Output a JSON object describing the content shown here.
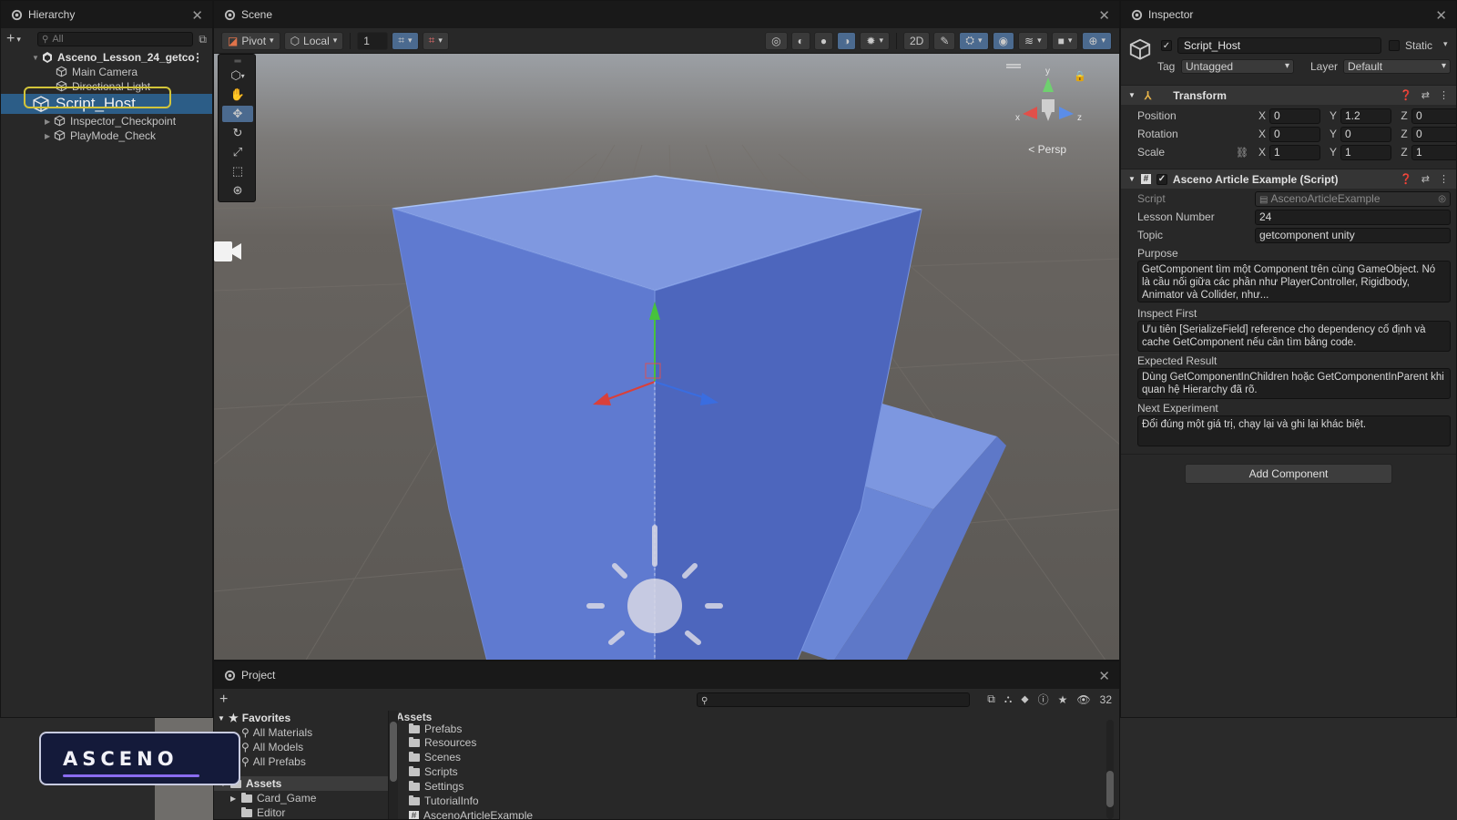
{
  "hierarchy": {
    "tab_title": "Hierarchy",
    "search_placeholder": "All",
    "items": [
      {
        "label": "Asceno_Lesson_24_getco",
        "type": "scene"
      },
      {
        "label": "Main Camera"
      },
      {
        "label": "Directional Light"
      },
      {
        "label": "Script_Host",
        "selected": true
      },
      {
        "label": "Inspector_Checkpoint"
      },
      {
        "label": "PlayMode_Check"
      }
    ]
  },
  "scene": {
    "tab_title": "Scene",
    "toolbar": {
      "pivot_label": "Pivot",
      "local_label": "Local",
      "grid_value": "1"
    },
    "persp_label": "< Persp",
    "gizmo_axes": {
      "y": "y",
      "z": "z",
      "x": "x"
    }
  },
  "project": {
    "tab_title": "Project",
    "hidden_count": "32",
    "favorites_label": "Favorites",
    "favorites": [
      "All Materials",
      "All Models",
      "All Prefabs"
    ],
    "assets_label": "Assets",
    "asset_tree": [
      "Card_Game",
      "Editor"
    ],
    "breadcrumb": "Assets",
    "folders": [
      "Prefabs",
      "Resources",
      "Scenes",
      "Scripts",
      "Settings",
      "TutorialInfo"
    ],
    "script_file": "AscenoArticleExample"
  },
  "inspector": {
    "tab_title": "Inspector",
    "object_name": "Script_Host",
    "static_label": "Static",
    "tag_label": "Tag",
    "tag_value": "Untagged",
    "layer_label": "Layer",
    "layer_value": "Default",
    "transform": {
      "title": "Transform",
      "position_label": "Position",
      "rotation_label": "Rotation",
      "scale_label": "Scale",
      "position": {
        "x": "0",
        "y": "1.2",
        "z": "0"
      },
      "rotation": {
        "x": "0",
        "y": "0",
        "z": "0"
      },
      "scale": {
        "x": "1",
        "y": "1",
        "z": "1"
      }
    },
    "script_component": {
      "title": "Asceno Article Example (Script)",
      "script_label": "Script",
      "script_value": "AscenoArticleExample",
      "lesson_label": "Lesson Number",
      "lesson_value": "24",
      "topic_label": "Topic",
      "topic_value": "getcomponent unity",
      "purpose_label": "Purpose",
      "purpose_value": "GetComponent tìm một Component trên cùng GameObject. Nó là cầu nối giữa các phần như PlayerController, Rigidbody, Animator và Collider, như...",
      "inspect_label": "Inspect First",
      "inspect_value": "Ưu tiên [SerializeField] reference cho dependency cố định và cache GetComponent nếu cần tìm bằng code.",
      "expected_label": "Expected Result",
      "expected_value": "Dùng GetComponentInChildren hoặc GetComponentInParent khi quan hệ Hierarchy đã rõ.",
      "next_label": "Next Experiment",
      "next_value": "Đổi đúng một giá trị, chạy lại và ghi lại khác biệt."
    },
    "add_component_label": "Add Component"
  },
  "logo": {
    "text": "ASCENO"
  },
  "colors": {
    "accent": "#2c5d87",
    "highlight": "#d2c43a",
    "cube": "#6a87d8"
  }
}
